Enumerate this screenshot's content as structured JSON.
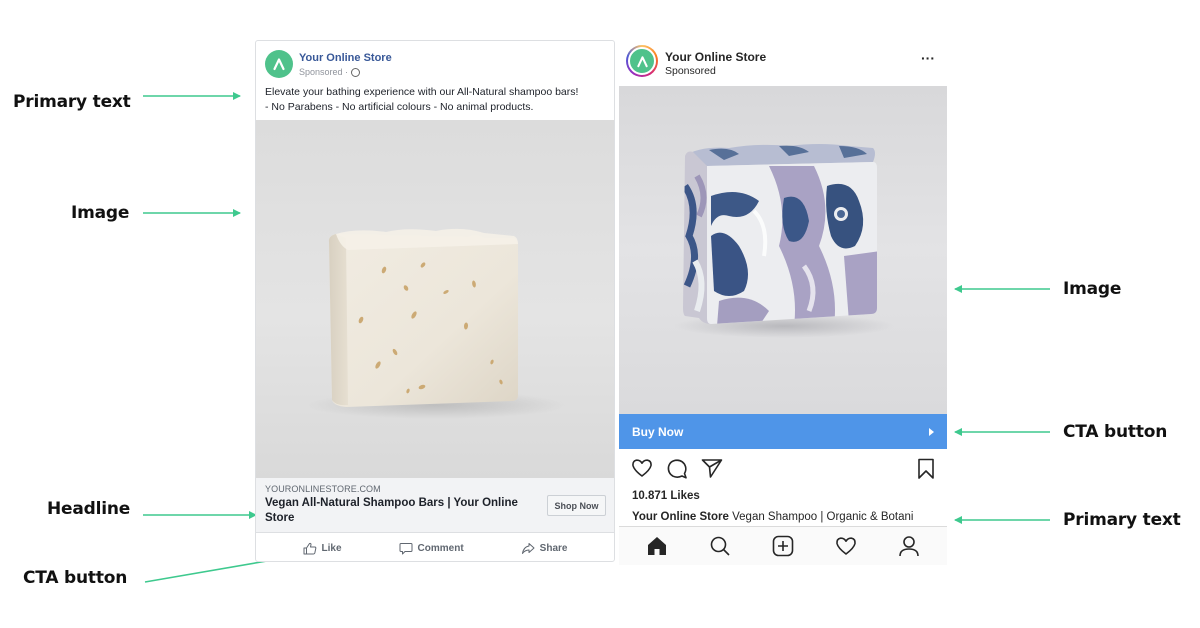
{
  "annotations": {
    "left": [
      {
        "label": "Primary text"
      },
      {
        "label": "Image"
      },
      {
        "label": "Headline"
      },
      {
        "label": "CTA button"
      }
    ],
    "right": [
      {
        "label": "Image"
      },
      {
        "label": "CTA button"
      },
      {
        "label": "Primary text"
      }
    ],
    "arrow_color": "#3ec98e"
  },
  "facebook_ad": {
    "page_name": "Your Online Store",
    "sponsored": "Sponsored ·",
    "primary_text_line1": "Elevate your bathing experience with our All-Natural shampoo bars!",
    "primary_text_line2": "- No Parabens - No artificial colours - No animal products.",
    "image_alt": "White oat soap bar",
    "domain": "YOURONLINESTORE.COM",
    "headline": "Vegan All-Natural Shampoo Bars | Your Online Store",
    "cta_label": "Shop Now",
    "actions": [
      {
        "label": "Like",
        "icon": "thumbs-up-icon"
      },
      {
        "label": "Comment",
        "icon": "comment-icon"
      },
      {
        "label": "Share",
        "icon": "share-icon"
      }
    ],
    "brand_color": "#4fc28b"
  },
  "instagram_ad": {
    "account_name": "Your Online Store",
    "sponsored": "Sponsored",
    "more_icon": "more-options-icon",
    "image_alt": "Blue and lilac marbled soap bar",
    "cta_label": "Buy Now",
    "cta_color": "#4f95e8",
    "likes": "10.871 Likes",
    "caption_user": "Your Online Store",
    "caption_text": " Vegan Shampoo | Organic & Botani",
    "action_icons": [
      "heart-icon",
      "comment-icon",
      "send-icon",
      "bookmark-icon"
    ],
    "nav_icons": [
      "home-icon",
      "search-icon",
      "add-post-icon",
      "activity-heart-icon",
      "profile-icon"
    ]
  }
}
